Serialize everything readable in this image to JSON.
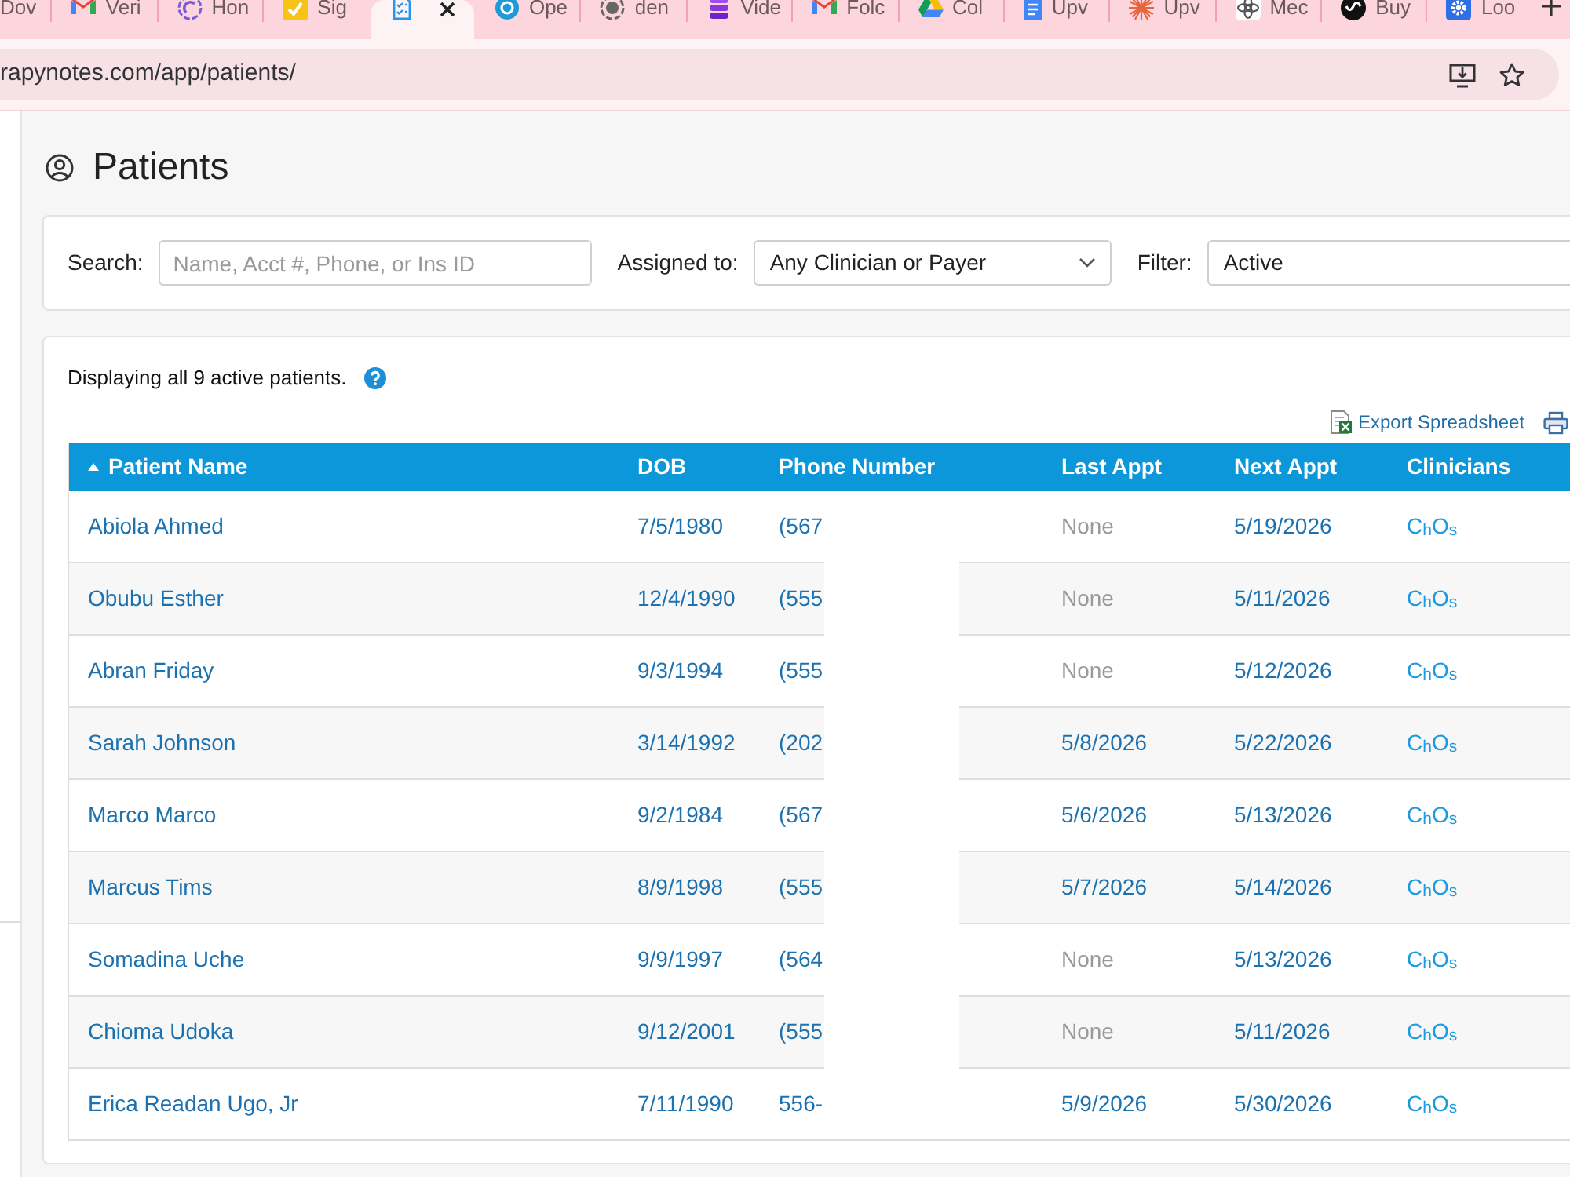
{
  "browser": {
    "tabs": [
      {
        "label": "Dov",
        "selected": false
      },
      {
        "label": "Veri",
        "selected": false
      },
      {
        "label": "Hon",
        "selected": false
      },
      {
        "label": "Sig",
        "selected": false
      },
      {
        "selected": true
      },
      {
        "label": "Ope",
        "selected": false
      },
      {
        "label": "den",
        "selected": false
      },
      {
        "label": "Vide",
        "selected": false
      },
      {
        "label": "Folc",
        "selected": false
      },
      {
        "label": "Col",
        "selected": false
      },
      {
        "label": "Upv",
        "selected": false
      },
      {
        "label": "Upv",
        "selected": false
      },
      {
        "label": "Mec",
        "selected": false
      },
      {
        "label": "Buy",
        "selected": false
      },
      {
        "label": "Loo",
        "selected": false
      }
    ],
    "url": "rapynotes.com/app/patients/"
  },
  "page": {
    "title": "Patients"
  },
  "filters": [
    {
      "kind": "text",
      "label": "Search:",
      "placeholder": "Name, Acct #, Phone, or Ins ID"
    },
    {
      "kind": "select",
      "label": "Assigned to:",
      "value": "Any Clinician or Payer"
    },
    {
      "kind": "box",
      "label": "Filter:",
      "value": "Active"
    }
  ],
  "summary": "Displaying all 9 active patients.",
  "export": "Export Spreadsheet",
  "table": {
    "columns": [
      {
        "label": "Patient Name",
        "sorted": true
      },
      {
        "label": "DOB",
        "sorted": false
      },
      {
        "label": "Phone Number",
        "sorted": false
      },
      {
        "label": "Last Appt",
        "sorted": false
      },
      {
        "label": "Next Appt",
        "sorted": false
      },
      {
        "label": "Clinicians",
        "sorted": false
      }
    ],
    "rows": [
      {
        "name": "Abiola Ahmed",
        "dob": "7/5/1980",
        "phone": "(567",
        "last_appt": "None",
        "last_appt_link": false,
        "next_appt": "5/19/2026",
        "clinicians": "C$_{h}$O$_{s}$"
      },
      {
        "name": "Obubu Esther",
        "dob": "12/4/1990",
        "phone": "(555",
        "last_appt": "None",
        "last_appt_link": false,
        "next_appt": "5/11/2026",
        "clinicians": "C$_{h}$O$_{s}$"
      },
      {
        "name": "Abran Friday",
        "dob": "9/3/1994",
        "phone": "(555",
        "last_appt": "None",
        "last_appt_link": false,
        "next_appt": "5/12/2026",
        "clinicians": "C$_{h}$O$_{s}$"
      },
      {
        "name": "Sarah Johnson",
        "dob": "3/14/1992",
        "phone": "(202",
        "last_appt": "5/8/2026",
        "last_appt_link": true,
        "next_appt": "5/22/2026",
        "clinicians": "C$_{h}$O$_{s}$"
      },
      {
        "name": "Marco Marco",
        "dob": "9/2/1984",
        "phone": "(567",
        "last_appt": "5/6/2026",
        "last_appt_link": true,
        "next_appt": "5/13/2026",
        "clinicians": "C$_{h}$O$_{s}$"
      },
      {
        "name": "Marcus Tims",
        "dob": "8/9/1998",
        "phone": "(555",
        "last_appt": "5/7/2026",
        "last_appt_link": true,
        "next_appt": "5/14/2026",
        "clinicians": "C$_{h}$O$_{s}$"
      },
      {
        "name": "Somadina Uche",
        "dob": "9/9/1997",
        "phone": "(564",
        "last_appt": "None",
        "last_appt_link": false,
        "next_appt": "5/13/2026",
        "clinicians": "C$_{h}$O$_{s}$"
      },
      {
        "name": "Chioma Udoka",
        "dob": "9/12/2001",
        "phone": "(555",
        "last_appt": "None",
        "last_appt_link": false,
        "next_appt": "5/11/2026",
        "clinicians": "C$_{h}$O$_{s}$"
      },
      {
        "name": "Erica Readan Ugo, Jr",
        "dob": "7/11/1990",
        "phone": "556-",
        "last_appt": "5/9/2026",
        "last_appt_link": true,
        "next_appt": "5/30/2026",
        "clinicians": "C$_{h}$O$_{s}$"
      }
    ]
  }
}
